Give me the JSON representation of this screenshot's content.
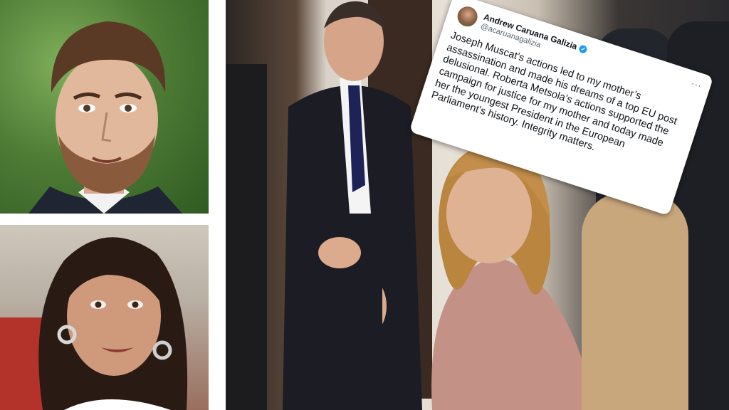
{
  "tweet": {
    "author_name": "Andrew Caruana Galizia",
    "author_handle": "@acaruanagalizia",
    "verified_icon": "verified-badge-icon",
    "more_icon": "more-options-icon",
    "more_label": "...",
    "text": "Joseph Muscat’s actions led to my mother’s assassination and made his dreams of a top EU post delusional. Roberta Metsola’s actions supported the campaign for justice for my mother and today made her the youngest President in the European Parliament’s history. Integrity matters.",
    "verified_color": "#1d9bf0"
  }
}
